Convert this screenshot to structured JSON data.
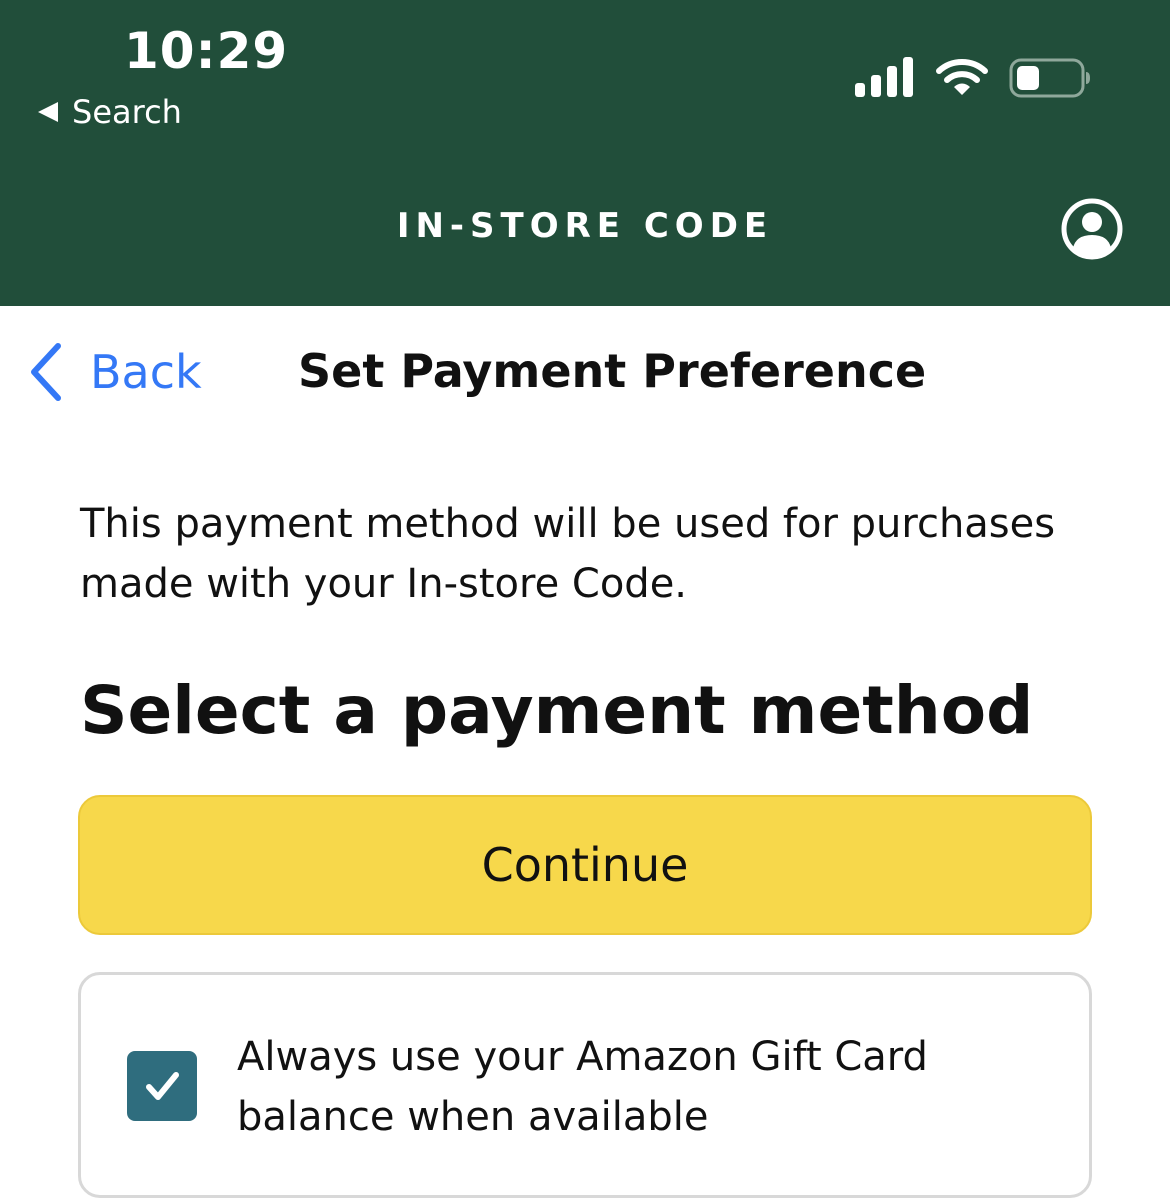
{
  "status_bar": {
    "time": "10:29",
    "back_app_label": "Search"
  },
  "header": {
    "title": "IN-STORE CODE"
  },
  "nav": {
    "back_label": "Back",
    "page_title": "Set Payment Preference"
  },
  "content": {
    "description": "This payment method will be used for purchases made with your In-store Code.",
    "section_heading": "Select a payment method",
    "continue_label": "Continue",
    "gift_card_option": {
      "label": "Always use your Amazon Gift Card balance when available",
      "checked": true
    }
  },
  "colors": {
    "header_bg": "#214e3a",
    "link_blue": "#3478f6",
    "continue_yellow": "#f7d84b",
    "checkbox_teal": "#2f6d7e"
  }
}
